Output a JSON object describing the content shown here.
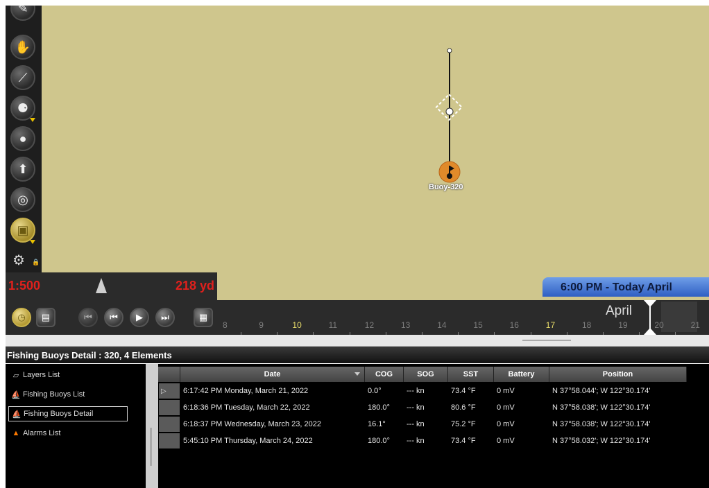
{
  "map": {
    "buoy_label": "Buoy-320",
    "scale_ratio": "1:500",
    "scale_distance": "218 yd",
    "time_banner": "6:00 PM - Today April"
  },
  "toolbar": {
    "tools": [
      "pan-hand-icon",
      "measure-compass-icon",
      "layers-icon",
      "target-icon",
      "route-icon",
      "globe-icon",
      "active-layer-icon"
    ],
    "settings": "gear-lock-icon"
  },
  "timeline": {
    "month": "April",
    "days": [
      "8",
      "9",
      "10",
      "11",
      "12",
      "13",
      "14",
      "15",
      "16",
      "17",
      "18",
      "19",
      "20",
      "21"
    ],
    "highlighted_days": [
      "10",
      "17"
    ]
  },
  "panel": {
    "title": "Fishing Buoys Detail : 320, 4 Elements",
    "nav": [
      {
        "label": "Layers List",
        "icon": "layers-outline-icon"
      },
      {
        "label": "Fishing Buoys List",
        "icon": "buoy-icon"
      },
      {
        "label": "Fishing Buoys Detail",
        "icon": "buoy-icon",
        "selected": true
      },
      {
        "label": "Alarms List",
        "icon": "alarm-warning-icon"
      }
    ]
  },
  "grid": {
    "columns": [
      "Date",
      "COG",
      "SOG",
      "SST",
      "Battery",
      "Position"
    ],
    "rows": [
      [
        "6:17:42 PM Monday, March 21, 2022",
        "0.0°",
        "--- kn",
        "73.4 °F",
        "0 mV",
        "N 37°58.044'; W 122°30.174'"
      ],
      [
        "6:18:36 PM Tuesday, March 22, 2022",
        "180.0°",
        "--- kn",
        "80.6 °F",
        "0 mV",
        "N 37°58.038'; W 122°30.174'"
      ],
      [
        "6:18:37 PM Wednesday, March 23, 2022",
        "16.1°",
        "--- kn",
        "75.2 °F",
        "0 mV",
        "N 37°58.038'; W 122°30.174'"
      ],
      [
        "5:45:10 PM Thursday, March 24, 2022",
        "180.0°",
        "--- kn",
        "73.4 °F",
        "0 mV",
        "N 37°58.032'; W 122°30.174'"
      ]
    ]
  },
  "colors": {
    "map_bg": "#cfc68d",
    "scale_red": "#e0201c",
    "banner_blue": "#2f5fc3",
    "buoy_orange": "#e08a2a"
  }
}
